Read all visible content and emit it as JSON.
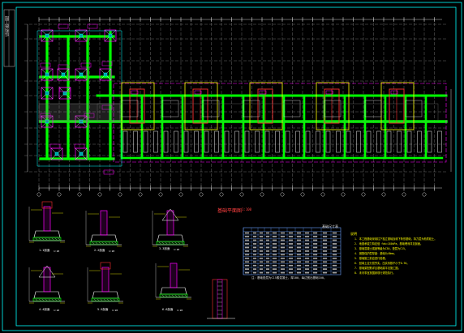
{
  "title_block": {
    "text": "结构施工图"
  },
  "plan": {
    "title": "基础平面图",
    "scale": "1:100"
  },
  "table": {
    "title": "基础尺寸表",
    "footnote": "注：基础垫层为C15素混凝土，厚100，每边宽出基础100。"
  },
  "notes": {
    "title": "说明",
    "items": [
      "1. 本工程基础采用柱下独立基础及墙下条形基础，持力层为粉质粘土。",
      "2. 地基承载力特征值 fak=180kPa，基础埋深详见剖面。",
      "3. 基础混凝土强度等级为C30，垫层为C15。",
      "4. 钢筋保护层厚度：基础为40mm。",
      "5. 基础施工前应进行验槽。",
      "6. 回填土应分层夯实，压实系数不小于0.94。",
      "7. 基础梁配筋详见基础梁平法施工图。",
      "8. 未尽事宜按国家现行规范执行。"
    ]
  },
  "details": [
    {
      "label": "1-1剖面",
      "scale": "1:20"
    },
    {
      "label": "2-2剖面",
      "scale": "1:20"
    },
    {
      "label": "3-3剖面",
      "scale": "1:20"
    },
    {
      "label": "4-4剖面",
      "scale": "1:20"
    },
    {
      "label": "5-5剖面",
      "scale": "1:20"
    },
    {
      "label": "6-6剖面",
      "scale": "1:20"
    }
  ],
  "colors": {
    "green": "#00ff00",
    "cyan": "#00ffff",
    "magenta": "#ff00ff",
    "yellow": "#ffff00",
    "red": "#ff3030",
    "white": "#ffffff",
    "blue": "#6aa0ff"
  }
}
